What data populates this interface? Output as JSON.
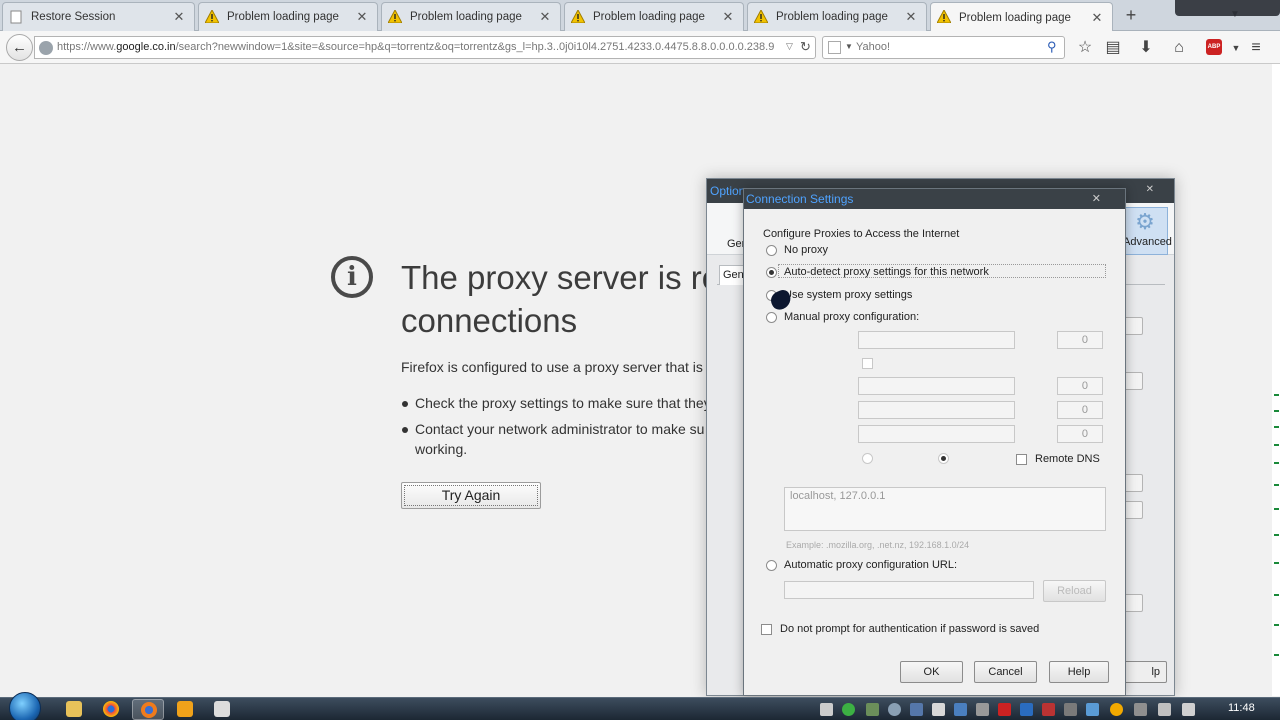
{
  "tabs": [
    {
      "label": "Restore Session",
      "icon": "document-icon",
      "active": false
    },
    {
      "label": "Problem loading page",
      "icon": "warning-icon",
      "active": false
    },
    {
      "label": "Problem loading page",
      "icon": "warning-icon",
      "active": false
    },
    {
      "label": "Problem loading page",
      "icon": "warning-icon",
      "active": false
    },
    {
      "label": "Problem loading page",
      "icon": "warning-icon",
      "active": false
    },
    {
      "label": "Problem loading page",
      "icon": "warning-icon",
      "active": true
    }
  ],
  "nav": {
    "url_prefix": "https://www.",
    "url_host": "google.co.in",
    "url_rest": "/search?newwindow=1&site=&source=hp&q=torrentz&oq=torrentz&gs_l=hp.3..0j0i10l4.2751.4233.0.4475.8.8.0.0.0.0.238.9",
    "search_placeholder": "Yahoo!"
  },
  "error_page": {
    "title_line1": "The proxy server is re",
    "title_line2": "connections",
    "description": "Firefox is configured to use a proxy server that is r",
    "bullets": [
      "Check the proxy settings to make sure that they",
      "Contact your network administrator to make su",
      "working."
    ],
    "try_again_label": "Try Again"
  },
  "options_dialog": {
    "title": "Option",
    "general_tab": "Gene",
    "toolbar_general": "Gen",
    "advanced_label": "Advanced",
    "help_label": "lp"
  },
  "connection_dialog": {
    "title": "Connection Settings",
    "group_label": "Configure Proxies to Access the Internet",
    "options": {
      "no_proxy": "No proxy",
      "auto_detect": "Auto-detect proxy settings for this network",
      "system": "Use system proxy settings",
      "manual": "Manual proxy configuration:",
      "auto_url": "Automatic proxy configuration URL:"
    },
    "selected": "auto_detect",
    "port_values": [
      "0",
      "0",
      "0",
      "0"
    ],
    "remote_dns_label": "Remote DNS",
    "no_proxy_for_value": "localhost, 127.0.0.1",
    "example_text": "Example: .mozilla.org, .net.nz, 192.168.1.0/24",
    "reload_label": "Reload",
    "auth_checkbox_label": "Do not prompt for authentication if password is saved",
    "ok_label": "OK",
    "cancel_label": "Cancel",
    "help_label": "Help"
  },
  "taskbar": {
    "clock": "11:48"
  },
  "colors": {
    "accent_title": "#4fa3ff",
    "titlebar": "#3a4147",
    "warning": "#f2c200"
  }
}
